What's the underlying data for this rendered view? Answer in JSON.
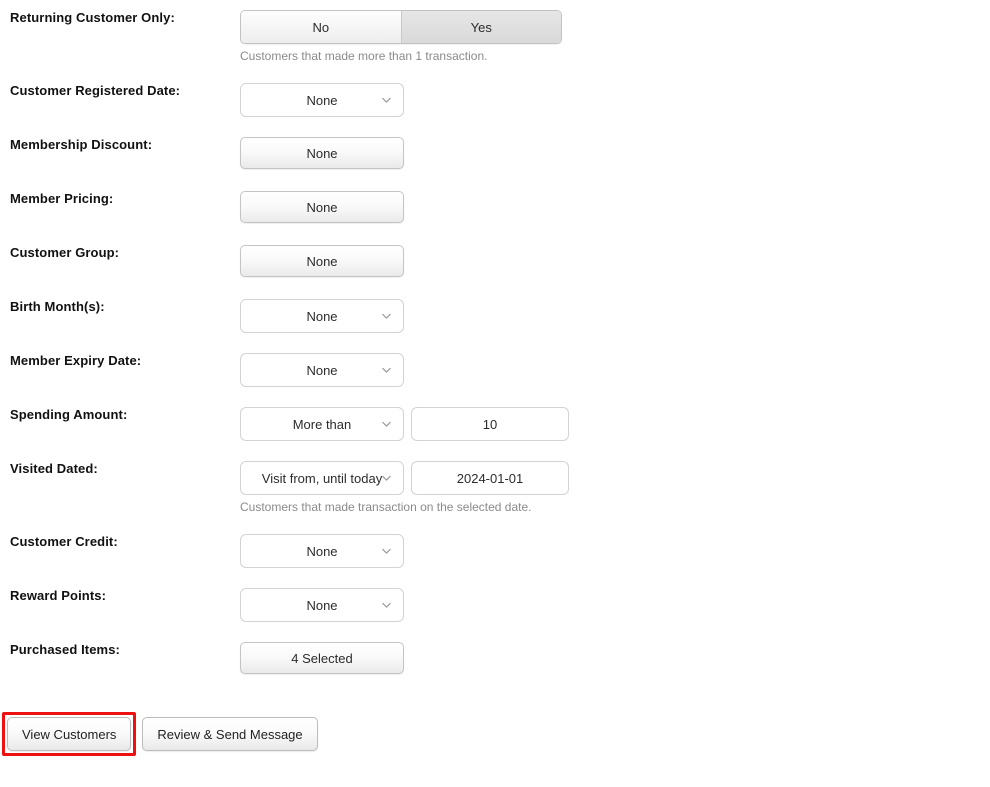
{
  "theme": {
    "highlight_color": "#ee1111",
    "label_color": "#111111",
    "help_text_color": "#8a8a8a",
    "control_text_color": "#2c2c2c"
  },
  "form": {
    "rows": [
      {
        "label": "Returning Customer Only:",
        "type": "toggle",
        "options": [
          "No",
          "Yes"
        ],
        "selected": "Yes",
        "help": "Customers that made more than 1 transaction."
      },
      {
        "label": "Customer Registered Date:",
        "type": "select",
        "value": "None"
      },
      {
        "label": "Membership Discount:",
        "type": "button",
        "value": "None"
      },
      {
        "label": "Member Pricing:",
        "type": "button",
        "value": "None"
      },
      {
        "label": "Customer Group:",
        "type": "button",
        "value": "None"
      },
      {
        "label": "Birth Month(s):",
        "type": "select",
        "value": "None"
      },
      {
        "label": "Member Expiry Date:",
        "type": "select",
        "value": "None"
      },
      {
        "label": "Spending Amount:",
        "type": "select-input",
        "value": "More than",
        "input_value": "10"
      },
      {
        "label": "Visited Dated:",
        "type": "select-input",
        "value": "Visit from, until today",
        "input_value": "2024-01-01",
        "help": "Customers that made transaction on the selected date."
      },
      {
        "label": "Customer Credit:",
        "type": "select",
        "value": "None"
      },
      {
        "label": "Reward Points:",
        "type": "select",
        "value": "None"
      },
      {
        "label": "Purchased Items:",
        "type": "button",
        "value": "4 Selected"
      }
    ]
  },
  "footer": {
    "view_customers_label": "View Customers",
    "review_send_label": "Review & Send Message"
  },
  "icons": {
    "chevron_down": "chevron-down-icon"
  }
}
